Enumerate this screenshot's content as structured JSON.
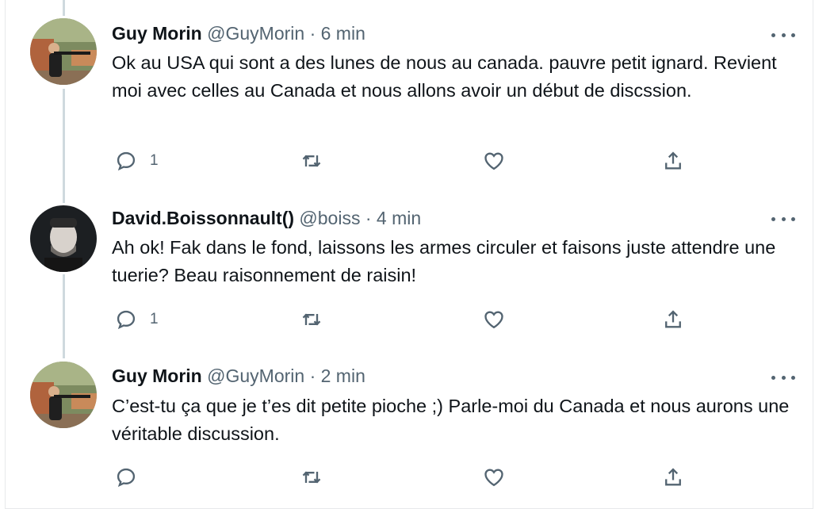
{
  "tweets": [
    {
      "name": "Guy Morin",
      "handle": "@GuyMorin",
      "sep": "·",
      "time": "6 min",
      "text": "Ok au USA qui sont a des lunes de nous au canada. pauvre petit ignard. Revient moi avec celles au Canada et nous allons avoir un début de discssion.",
      "reply_count": "1",
      "avatar": "avatar-shooter"
    },
    {
      "name": "David.Boissonnault()",
      "handle": "@boiss",
      "sep": "·",
      "time": "4 min",
      "text": "Ah ok! Fak dans le fond, laissons les armes circuler et faisons juste attendre une tuerie? Beau raisonnement de raisin!",
      "reply_count": "1",
      "avatar": "avatar-portrait"
    },
    {
      "name": "Guy Morin",
      "handle": "@GuyMorin",
      "sep": "·",
      "time": "2 min",
      "text": "C’est-tu ça que je t’es dit petite pioche ;) Parle-moi du Canada et nous aurons une véritable discussion.",
      "reply_count": "",
      "avatar": "avatar-shooter"
    }
  ],
  "colors": {
    "text": "#0f1419",
    "secondary": "#536471",
    "thread_line": "#cfd9de"
  },
  "icons": [
    "reply-icon",
    "retweet-icon",
    "like-icon",
    "share-icon",
    "more-icon"
  ]
}
